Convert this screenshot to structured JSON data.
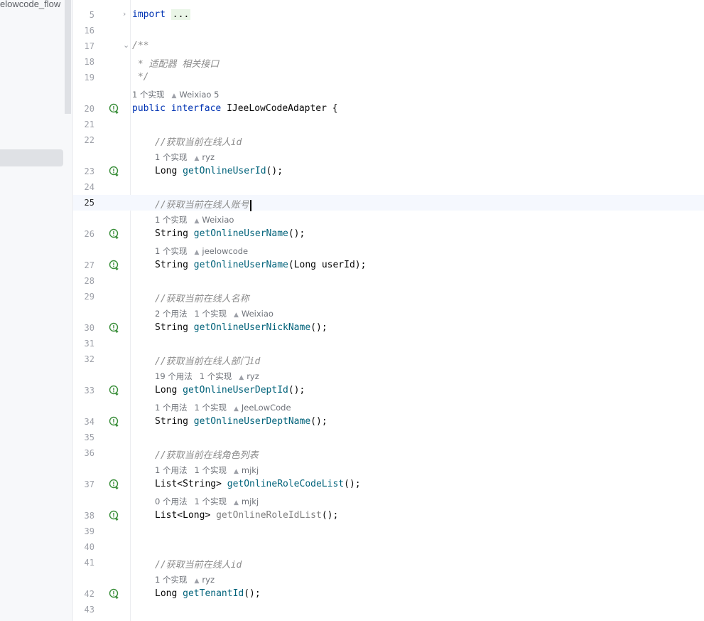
{
  "sidebar": {
    "crumb": "elowcode_flow"
  },
  "editor": {
    "lines": [
      {
        "n": "5",
        "type": "code",
        "fold": "›",
        "parts": [
          {
            "t": "import",
            "c": "kw"
          },
          {
            "t": " "
          },
          {
            "t": "...",
            "c": "fold-box"
          }
        ]
      },
      {
        "n": "16",
        "type": "blank"
      },
      {
        "n": "17",
        "type": "code",
        "fold": "⌄",
        "parts": [
          {
            "t": "/**",
            "c": "cmt"
          }
        ]
      },
      {
        "n": "18",
        "type": "code",
        "parts": [
          {
            "t": " * 适配器 相关接口",
            "c": "cmt"
          }
        ]
      },
      {
        "n": "19",
        "type": "code",
        "parts": [
          {
            "t": " */",
            "c": "cmt"
          }
        ]
      },
      {
        "type": "hint",
        "items": [
          "1 个实现"
        ],
        "author": "Weixiao 5"
      },
      {
        "n": "20",
        "type": "code",
        "impl": true,
        "parts": [
          {
            "t": "public",
            "c": "kw"
          },
          {
            "t": " "
          },
          {
            "t": "interface",
            "c": "kw"
          },
          {
            "t": " IJeeLowCodeAdapter {"
          }
        ]
      },
      {
        "n": "21",
        "type": "blank"
      },
      {
        "n": "22",
        "type": "code",
        "indent": true,
        "parts": [
          {
            "t": "//获取当前在线人id",
            "c": "cmt"
          }
        ]
      },
      {
        "type": "hint",
        "indent": true,
        "items": [
          "1 个实现"
        ],
        "author": "ryz"
      },
      {
        "n": "23",
        "type": "code",
        "impl": true,
        "indent": true,
        "parts": [
          {
            "t": "Long "
          },
          {
            "t": "getOnlineUserId",
            "c": "mth"
          },
          {
            "t": "();"
          }
        ]
      },
      {
        "n": "24",
        "type": "blank"
      },
      {
        "n": "25",
        "type": "code",
        "current": true,
        "indent": true,
        "caret": true,
        "parts": [
          {
            "t": "//获取当前在线人账号",
            "c": "cmt"
          }
        ]
      },
      {
        "type": "hint",
        "indent": true,
        "items": [
          "1 个实现"
        ],
        "author": "Weixiao"
      },
      {
        "n": "26",
        "type": "code",
        "impl": true,
        "indent": true,
        "parts": [
          {
            "t": "String "
          },
          {
            "t": "getOnlineUserName",
            "c": "mth"
          },
          {
            "t": "();"
          }
        ]
      },
      {
        "type": "hint",
        "indent": true,
        "items": [
          "1 个实现"
        ],
        "author": "jeelowcode"
      },
      {
        "n": "27",
        "type": "code",
        "impl": true,
        "indent": true,
        "parts": [
          {
            "t": "String "
          },
          {
            "t": "getOnlineUserName",
            "c": "mth"
          },
          {
            "t": "(Long userId);"
          }
        ]
      },
      {
        "n": "28",
        "type": "blank"
      },
      {
        "n": "29",
        "type": "code",
        "indent": true,
        "parts": [
          {
            "t": "//获取当前在线人名称",
            "c": "cmt"
          }
        ]
      },
      {
        "type": "hint",
        "indent": true,
        "items": [
          "2 个用法",
          "1 个实现"
        ],
        "author": "Weixiao"
      },
      {
        "n": "30",
        "type": "code",
        "impl": true,
        "indent": true,
        "parts": [
          {
            "t": "String "
          },
          {
            "t": "getOnlineUserNickName",
            "c": "mth"
          },
          {
            "t": "();"
          }
        ]
      },
      {
        "n": "31",
        "type": "blank"
      },
      {
        "n": "32",
        "type": "code",
        "indent": true,
        "parts": [
          {
            "t": "//获取当前在线人部门id",
            "c": "cmt"
          }
        ]
      },
      {
        "type": "hint",
        "indent": true,
        "items": [
          "19 个用法",
          "1 个实现"
        ],
        "author": "ryz"
      },
      {
        "n": "33",
        "type": "code",
        "impl": true,
        "indent": true,
        "parts": [
          {
            "t": "Long "
          },
          {
            "t": "getOnlineUserDeptId",
            "c": "mth"
          },
          {
            "t": "();"
          }
        ]
      },
      {
        "type": "hint",
        "indent": true,
        "items": [
          "1 个用法",
          "1 个实现"
        ],
        "author": "JeeLowCode"
      },
      {
        "n": "34",
        "type": "code",
        "impl": true,
        "indent": true,
        "parts": [
          {
            "t": "String "
          },
          {
            "t": "getOnlineUserDeptName",
            "c": "mth"
          },
          {
            "t": "();"
          }
        ]
      },
      {
        "n": "35",
        "type": "blank"
      },
      {
        "n": "36",
        "type": "code",
        "indent": true,
        "parts": [
          {
            "t": "//获取当前在线角色列表",
            "c": "cmt"
          }
        ]
      },
      {
        "type": "hint",
        "indent": true,
        "items": [
          "1 个用法",
          "1 个实现"
        ],
        "author": "mjkj"
      },
      {
        "n": "37",
        "type": "code",
        "impl": true,
        "indent": true,
        "parts": [
          {
            "t": "List<String> "
          },
          {
            "t": "getOnlineRoleCodeList",
            "c": "mth"
          },
          {
            "t": "();"
          }
        ]
      },
      {
        "type": "hint",
        "indent": true,
        "items": [
          "0 个用法",
          "1 个实现"
        ],
        "author": "mjkj"
      },
      {
        "n": "38",
        "type": "code",
        "impl": true,
        "indent": true,
        "parts": [
          {
            "t": "List<Long> "
          },
          {
            "t": "getOnlineRoleIdList",
            "c": "mth-unused"
          },
          {
            "t": "();"
          }
        ]
      },
      {
        "n": "39",
        "type": "blank"
      },
      {
        "n": "40",
        "type": "blank"
      },
      {
        "n": "41",
        "type": "code",
        "indent": true,
        "parts": [
          {
            "t": "//获取当前在线人id",
            "c": "cmt"
          }
        ]
      },
      {
        "type": "hint",
        "indent": true,
        "items": [
          "1 个实现"
        ],
        "author": "ryz"
      },
      {
        "n": "42",
        "type": "code",
        "impl": true,
        "indent": true,
        "parts": [
          {
            "t": "Long "
          },
          {
            "t": "getTenantId",
            "c": "mth"
          },
          {
            "t": "();"
          }
        ]
      },
      {
        "n": "43",
        "type": "blank"
      }
    ]
  }
}
